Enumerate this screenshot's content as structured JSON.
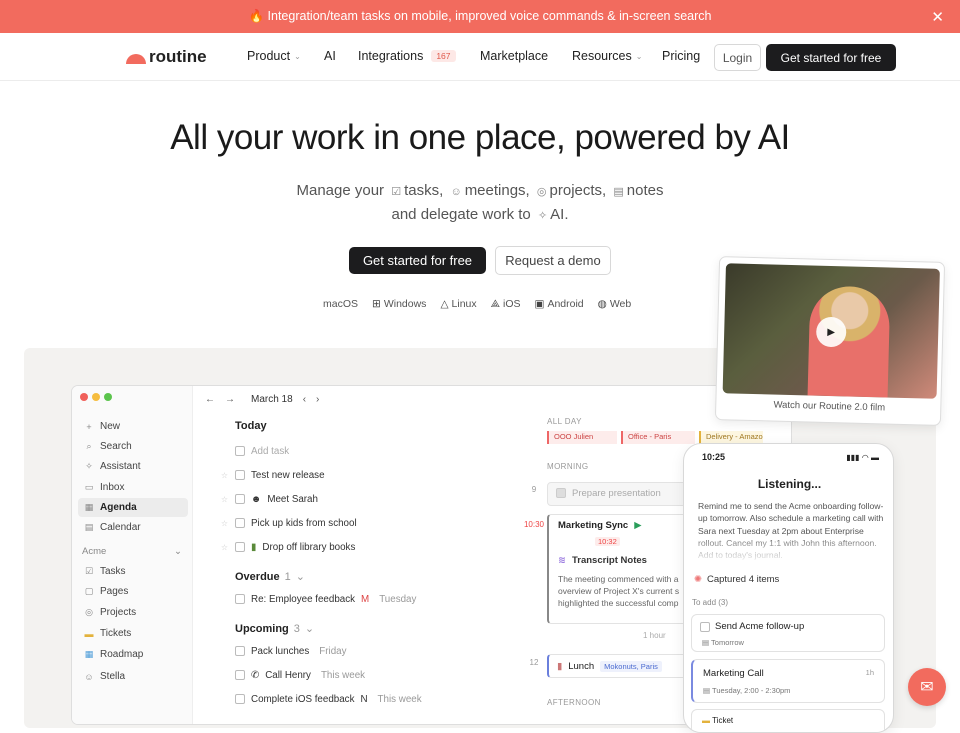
{
  "banner": {
    "text": "🔥 Integration/team tasks on mobile, improved voice commands & in-screen search",
    "close": "✕"
  },
  "nav": {
    "logo": "routine",
    "items": [
      "Product",
      "AI",
      "Integrations",
      "Marketplace",
      "Resources",
      "Pricing"
    ],
    "integrations_badge": "167",
    "login": "Login",
    "cta": "Get started for free"
  },
  "hero": {
    "title": "All your work in one place, powered by AI",
    "sub_lead": "Manage your",
    "sub_items": [
      "tasks,",
      "meetings,",
      "projects,",
      "notes"
    ],
    "sub_line2_a": "and delegate work to",
    "sub_line2_b": "AI.",
    "cta_primary": "Get started for free",
    "cta_secondary": "Request a demo",
    "platforms": [
      "macOS",
      "Windows",
      "Linux",
      "iOS",
      "Android",
      "Web"
    ]
  },
  "app": {
    "date": "March 18",
    "sidebar": [
      "New",
      "Search",
      "Assistant",
      "Inbox",
      "Agenda",
      "Calendar"
    ],
    "workspace": "Acme",
    "workspace_items": [
      "Tasks",
      "Pages",
      "Projects",
      "Tickets",
      "Roadmap",
      "Stella"
    ],
    "today_label": "Today",
    "add_task": "Add task",
    "today_tasks": [
      "Test new release",
      "Meet Sarah",
      "Pick up kids from school",
      "Drop off library books"
    ],
    "overdue_label": "Overdue",
    "overdue_count": "1",
    "overdue_task": "Re: Employee feedback",
    "overdue_meta": "Tuesday",
    "upcoming_label": "Upcoming",
    "upcoming_count": "3",
    "upcoming_tasks": [
      {
        "title": "Pack lunches",
        "meta": "Friday"
      },
      {
        "title": "Call Henry",
        "meta": "This week"
      },
      {
        "title": "Complete iOS feedback",
        "meta": "This week"
      }
    ],
    "cal": {
      "all_day": "ALL DAY",
      "chips": [
        "OOO Julien",
        "Office - Paris",
        "Delivery - Amazo"
      ],
      "morning": "MORNING",
      "prep": "Prepare presentation",
      "t9": "9",
      "t1030": "10:30",
      "sync_title": "Marketing Sync",
      "sync_time": "10:32",
      "notes_title": "Transcript Notes",
      "notes_text": "The meeting commenced with a overview of Project X's current s highlighted the successful comp",
      "hour": "1 hour",
      "t12": "12",
      "lunch": "Lunch",
      "lunch_loc": "Mokonuts, Paris",
      "afternoon": "AFTERNOON"
    }
  },
  "video": {
    "caption": "Watch our Routine 2.0 film"
  },
  "phone": {
    "time": "10:25",
    "listening": "Listening...",
    "prompt": "Remind me to send the Acme onboarding follow-up tomorrow. Also schedule a marketing call with Sara next Tuesday at 2pm about Enterprise rollout. Cancel my 1:1 with John this afternoon. Add to today's journal.",
    "captured": "Captured 4 items",
    "to_add": "To add (3)",
    "item1": "Send Acme follow-up",
    "item1_meta": "Tomorrow",
    "item2": "Marketing Call",
    "item2_dur": "1h",
    "item2_meta": "Tuesday, 2:00 - 2:30pm",
    "item3": "Ticket"
  }
}
